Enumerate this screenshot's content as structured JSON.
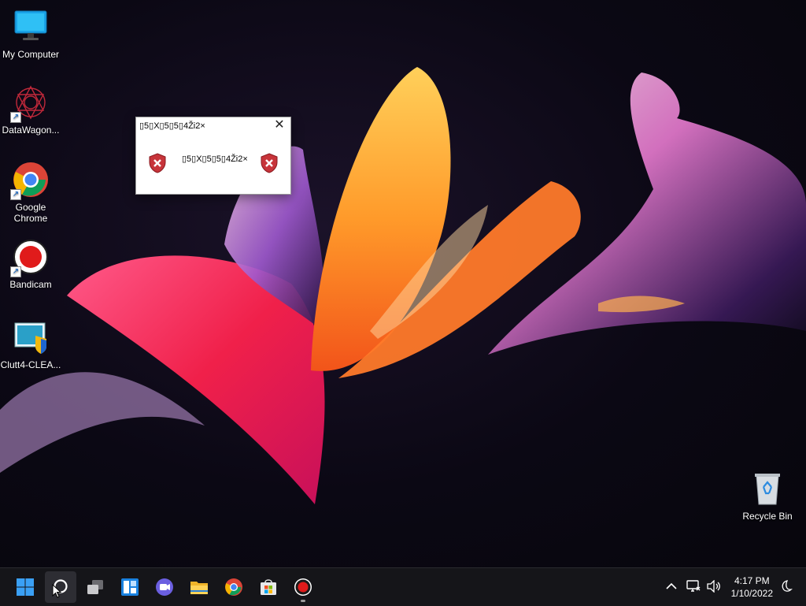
{
  "desktop": {
    "icons": [
      {
        "label": "My Computer",
        "icon": "monitor-icon"
      },
      {
        "label": "DataWagon...",
        "icon": "datawagon-icon"
      },
      {
        "label": "Google Chrome",
        "icon": "chrome-icon"
      },
      {
        "label": "Bandicam",
        "icon": "bandicam-icon"
      },
      {
        "label": "Clutt4-CLEA...",
        "icon": "clutt-icon"
      },
      {
        "label": "Recycle Bin",
        "icon": "recycle-bin-icon"
      }
    ]
  },
  "dialog": {
    "title": "▯5▯X▯5▯5▯4Ži2×",
    "message": "▯5▯X▯5▯5▯4Ži2×",
    "close_label": "✕"
  },
  "taskbar": {
    "items": [
      {
        "name": "start",
        "icon": "windows-logo-icon"
      },
      {
        "name": "search",
        "icon": "search-icon",
        "active": true
      },
      {
        "name": "task-view",
        "icon": "task-view-icon"
      },
      {
        "name": "widgets",
        "icon": "widgets-icon"
      },
      {
        "name": "chat",
        "icon": "chat-icon"
      },
      {
        "name": "file-explorer",
        "icon": "folder-icon"
      },
      {
        "name": "chrome",
        "icon": "chrome-icon"
      },
      {
        "name": "store",
        "icon": "store-icon"
      },
      {
        "name": "bandicam",
        "icon": "bandicam-icon",
        "running": true
      }
    ],
    "tray": {
      "chevron": "^",
      "time": "4:17 PM",
      "date": "1/10/2022"
    }
  },
  "colors": {
    "taskbar": "#151519",
    "accent_blue": "#0a84ff",
    "bandicam_red": "#e01b1b"
  }
}
